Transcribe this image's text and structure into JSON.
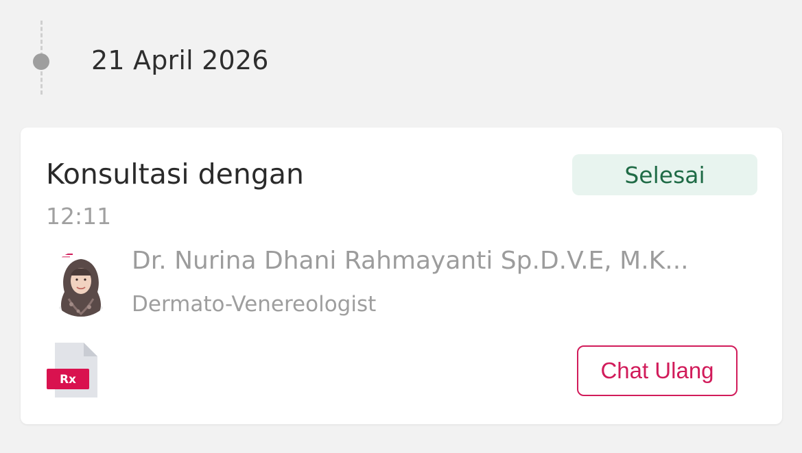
{
  "timeline": {
    "date": "21 April 2026"
  },
  "consultation": {
    "title": "Konsultasi dengan",
    "time": "12:11",
    "status": "Selesai",
    "doctor": {
      "name": "Dr. Nurina Dhani Rahmayanti Sp.D.V.E, M.K...",
      "specialty": "Dermato-Venereologist"
    },
    "prescription": {
      "icon": "prescription-file-icon",
      "label": "Rx"
    },
    "actions": {
      "chat_again": "Chat Ulang"
    }
  },
  "colors": {
    "background": "#f2f2f2",
    "card": "#ffffff",
    "status_bg": "#e8f4ef",
    "status_text": "#1f6b46",
    "accent": "#d11b5a",
    "muted_text": "#9e9e9e"
  }
}
